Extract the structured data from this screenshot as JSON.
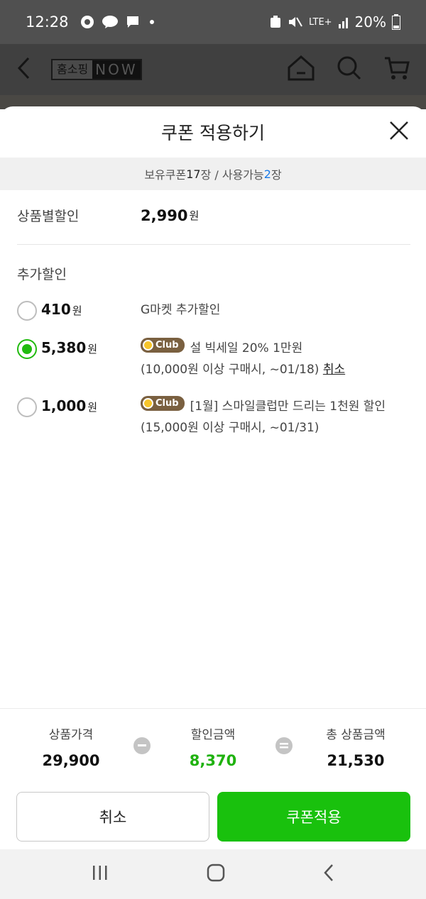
{
  "status_bar": {
    "time": "12:28",
    "network": "LTE+",
    "battery": "20%",
    "icons": [
      "chrome-icon",
      "talk-icon",
      "message-icon",
      "dot-icon",
      "alarm-icon",
      "mute-icon",
      "signal-icon",
      "battery-icon"
    ],
    "talk_text": "TALK"
  },
  "header": {
    "logo_left": "홈소핑",
    "logo_right": "NOW"
  },
  "sheet": {
    "title": "쿠폰 적용하기",
    "summary": {
      "owned_label": "보유쿠폰 ",
      "owned_count": "17",
      "owned_unit": "장 / 사용가능 ",
      "usable_count": "2",
      "usable_unit": "장"
    },
    "product_discount": {
      "label": "상품별할인",
      "amount": "2,990",
      "unit": "원"
    },
    "additional_title": "추가할인",
    "options": [
      {
        "amount": "410",
        "unit": "원",
        "selected": false,
        "desc": "G마켓 추가할인"
      },
      {
        "amount": "5,380",
        "unit": "원",
        "selected": true,
        "badge": "Club",
        "desc": "설 빅세일 20% 1만원",
        "condition": "(10,000원 이상 구매시, ~01/18)",
        "cancel_link": "취소"
      },
      {
        "amount": "1,000",
        "unit": "원",
        "selected": false,
        "badge": "Club",
        "desc": "[1월] 스마일클럽만 드리는 1천원 할인",
        "condition": "(15,000원 이상 구매시, ~01/31)"
      }
    ]
  },
  "totals": {
    "product_price_label": "상품가격",
    "product_price": "29,900",
    "discount_label": "할인금액",
    "discount": "8,370",
    "total_label": "총 상품금액",
    "total": "21,530"
  },
  "buttons": {
    "cancel": "취소",
    "apply": "쿠폰적용"
  },
  "colors": {
    "accent_green": "#19c10d",
    "discount_green": "#1fb20f",
    "usable_blue": "#1a7be8",
    "club_badge": "#7a6040"
  }
}
